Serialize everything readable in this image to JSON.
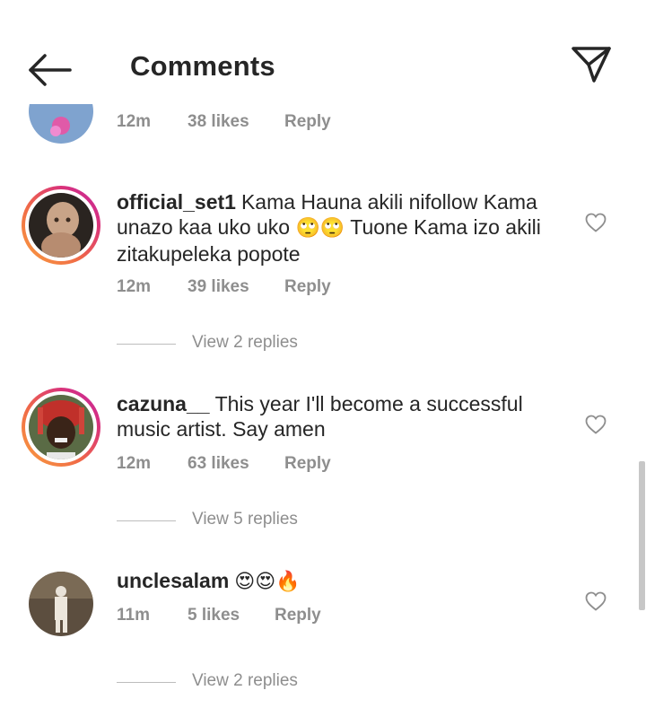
{
  "header": {
    "title": "Comments"
  },
  "partial_comment": {
    "time": "12m",
    "likes": "38 likes",
    "reply": "Reply"
  },
  "comments": [
    {
      "username": "official_set1",
      "text": "Kama Hauna akili nifollow Kama unazo kaa uko uko",
      "emoji_mid": "🙄🙄",
      "text_tail": "Tuone Kama izo akili zitakupeleka popote",
      "time": "12m",
      "likes": "39 likes",
      "reply": "Reply",
      "replies": "View 2 replies"
    },
    {
      "username": "cazuna__",
      "text": "This year I'll become a successful music artist. Say amen",
      "time": "12m",
      "likes": "63 likes",
      "reply": "Reply",
      "replies": "View 5 replies"
    },
    {
      "username": "unclesalam",
      "emoji": "😍😍🔥",
      "time": "11m",
      "likes": "5 likes",
      "reply": "Reply",
      "replies": "View 2 replies"
    }
  ]
}
